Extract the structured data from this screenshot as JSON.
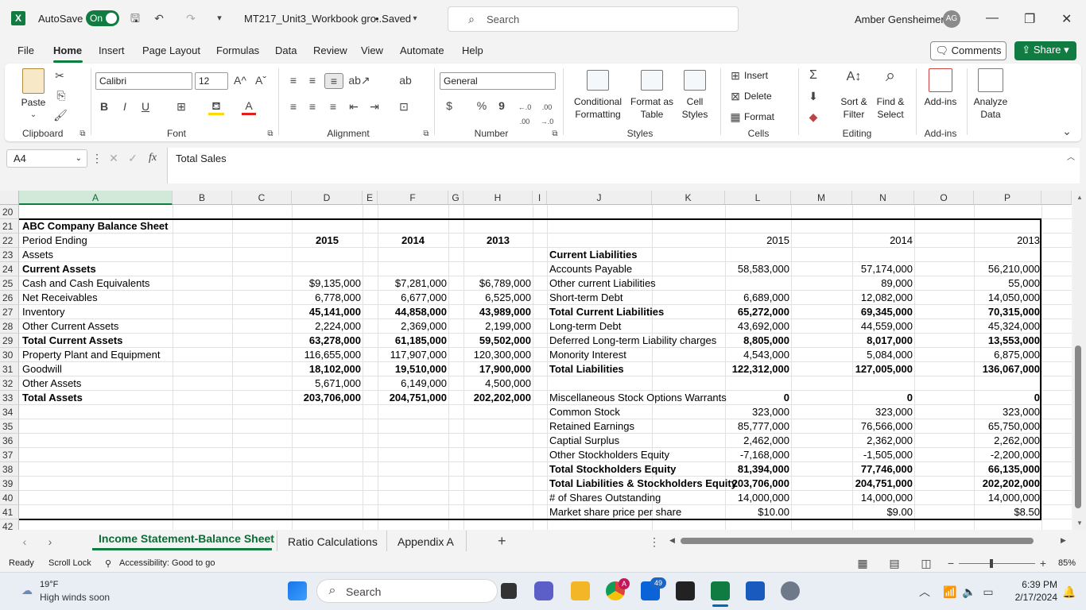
{
  "titlebar": {
    "autosave_label": "AutoSave",
    "autosave_state": "On",
    "filename": "MT217_Unit3_Workbook gro...",
    "saved_status": "• Saved",
    "search_placeholder": "Search",
    "user_name": "Amber Gensheimer",
    "user_initials": "AG"
  },
  "menu": {
    "items": [
      "File",
      "Home",
      "Insert",
      "Page Layout",
      "Formulas",
      "Data",
      "Review",
      "View",
      "Automate",
      "Help"
    ],
    "active": "Home",
    "comments_label": "Comments",
    "share_label": "Share"
  },
  "ribbon": {
    "clipboard": {
      "paste": "Paste",
      "label": "Clipboard"
    },
    "font": {
      "name": "Calibri",
      "size": "12",
      "bold": "B",
      "italic": "I",
      "underline": "U",
      "grow": "A^",
      "shrink": "Aˇ",
      "label": "Font"
    },
    "alignment": {
      "label": "Alignment"
    },
    "number": {
      "format": "General",
      "currency": "$",
      "percent": "%",
      "comma": "9",
      "inc_dec": "←.0 .00",
      "dec_dec": ".00 →.0",
      "label": "Number"
    },
    "styles": {
      "conditional_1": "Conditional",
      "conditional_2": "Formatting",
      "table_1": "Format as",
      "table_2": "Table",
      "cell_1": "Cell",
      "cell_2": "Styles",
      "label": "Styles"
    },
    "cells": {
      "insert": "Insert",
      "delete": "Delete",
      "format": "Format",
      "label": "Cells"
    },
    "editing": {
      "sort_1": "Sort &",
      "sort_2": "Filter",
      "find_1": "Find &",
      "find_2": "Select",
      "label": "Editing"
    },
    "addins": {
      "addins": "Add-ins",
      "label": "Add-ins"
    },
    "analyze": {
      "line1": "Analyze",
      "line2": "Data"
    }
  },
  "formula_bar": {
    "name_box": "A4",
    "fx": "fx",
    "content": "Total Sales"
  },
  "columns": [
    "A",
    "B",
    "C",
    "D",
    "E",
    "F",
    "G",
    "H",
    "I",
    "J",
    "K",
    "L",
    "M",
    "N",
    "O",
    "P"
  ],
  "rows": [
    "20",
    "21",
    "22",
    "23",
    "24",
    "25",
    "26",
    "27",
    "28",
    "29",
    "30",
    "31",
    "32",
    "33",
    "34",
    "35",
    "36",
    "37",
    "38",
    "39",
    "40",
    "41",
    "42"
  ],
  "sheet": {
    "rows": [
      {
        "A": "",
        "D": "",
        "F": "",
        "H": "",
        "J": "",
        "L": "",
        "N": "",
        "P": ""
      },
      {
        "A": "ABC Company Balance Sheet",
        "D": "",
        "F": "",
        "H": "",
        "J": "",
        "L": "",
        "N": "",
        "P": ""
      },
      {
        "A": "Period Ending",
        "D": "2015",
        "F": "2014",
        "H": "2013",
        "J": "",
        "L": "2015",
        "N": "2014",
        "P": "2013"
      },
      {
        "A": "Assets",
        "D": "",
        "F": "",
        "H": "",
        "J": "Current Liabilities",
        "L": "",
        "N": "",
        "P": ""
      },
      {
        "A": "Current Assets",
        "D": "",
        "F": "",
        "H": "",
        "J": "Accounts Payable",
        "L": "58,583,000",
        "N": "57,174,000",
        "P": "56,210,000"
      },
      {
        "A": "Cash and Cash Equivalents",
        "D": "$9,135,000",
        "F": "$7,281,000",
        "H": "$6,789,000",
        "J": "Other current Liabilities",
        "L": "",
        "N": "89,000",
        "P": "55,000"
      },
      {
        "A": "Net Receivables",
        "D": "6,778,000",
        "F": "6,677,000",
        "H": "6,525,000",
        "J": "Short-term Debt",
        "L": "6,689,000",
        "N": "12,082,000",
        "P": "14,050,000"
      },
      {
        "A": "Inventory",
        "D": "45,141,000",
        "F": "44,858,000",
        "H": "43,989,000",
        "J": "Total Current Liabilities",
        "L": "65,272,000",
        "N": "69,345,000",
        "P": "70,315,000"
      },
      {
        "A": "Other Current Assets",
        "D": "2,224,000",
        "F": "2,369,000",
        "H": "2,199,000",
        "J": "Long-term Debt",
        "L": "43,692,000",
        "N": "44,559,000",
        "P": "45,324,000"
      },
      {
        "A": "Total Current Assets",
        "D": "63,278,000",
        "F": "61,185,000",
        "H": "59,502,000",
        "J": "Deferred Long-term Liability charges",
        "L": "8,805,000",
        "N": "8,017,000",
        "P": "13,553,000"
      },
      {
        "A": "Property Plant and Equipment",
        "D": "116,655,000",
        "F": "117,907,000",
        "H": "120,300,000",
        "J": "Monority Interest",
        "L": "4,543,000",
        "N": "5,084,000",
        "P": "6,875,000"
      },
      {
        "A": "Goodwill",
        "D": "18,102,000",
        "F": "19,510,000",
        "H": "17,900,000",
        "J": "Total Liabilities",
        "L": "122,312,000",
        "N": "127,005,000",
        "P": "136,067,000"
      },
      {
        "A": "Other Assets",
        "D": "5,671,000",
        "F": "6,149,000",
        "H": "4,500,000",
        "J": "",
        "L": "",
        "N": "",
        "P": ""
      },
      {
        "A": "Total Assets",
        "D": "203,706,000",
        "F": "204,751,000",
        "H": "202,202,000",
        "J": "Miscellaneous Stock Options Warrants",
        "L": "0",
        "N": "0",
        "P": "0"
      },
      {
        "A": "",
        "D": "",
        "F": "",
        "H": "",
        "J": "Common Stock",
        "L": "323,000",
        "N": "323,000",
        "P": "323,000"
      },
      {
        "A": "",
        "D": "",
        "F": "",
        "H": "",
        "J": "Retained Earnings",
        "L": "85,777,000",
        "N": "76,566,000",
        "P": "65,750,000"
      },
      {
        "A": "",
        "D": "",
        "F": "",
        "H": "",
        "J": "Captial Surplus",
        "L": "2,462,000",
        "N": "2,362,000",
        "P": "2,262,000"
      },
      {
        "A": "",
        "D": "",
        "F": "",
        "H": "",
        "J": "Other Stockholders Equity",
        "L": "-7,168,000",
        "N": "-1,505,000",
        "P": "-2,200,000"
      },
      {
        "A": "",
        "D": "",
        "F": "",
        "H": "",
        "J": "Total Stockholders Equity",
        "L": "81,394,000",
        "N": "77,746,000",
        "P": "66,135,000"
      },
      {
        "A": "",
        "D": "",
        "F": "",
        "H": "",
        "J": "Total Liabilities & Stockholders Equity",
        "L": "203,706,000",
        "N": "204,751,000",
        "P": "202,202,000"
      },
      {
        "A": "",
        "D": "",
        "F": "",
        "H": "",
        "J": "# of Shares Outstanding",
        "L": "14,000,000",
        "N": "14,000,000",
        "P": "14,000,000"
      },
      {
        "A": "",
        "D": "",
        "F": "",
        "H": "",
        "J": "Market share price per share",
        "L": "$10.00",
        "N": "$9.00",
        "P": "$8.50"
      },
      {
        "A": "",
        "D": "",
        "F": "",
        "H": "",
        "J": "",
        "L": "",
        "N": "",
        "P": ""
      }
    ],
    "bold_rows": [
      1,
      2,
      4,
      7,
      9,
      11,
      13,
      18,
      19
    ],
    "bold_a_rows": [
      1,
      4,
      9,
      13
    ],
    "bold_j_rows": [
      3,
      7,
      11,
      18,
      19
    ]
  },
  "sheet_tabs": {
    "tabs": [
      "Income Statement-Balance Sheet",
      "Ratio Calculations",
      "Appendix A"
    ],
    "active": "Income Statement-Balance Sheet",
    "add": "+"
  },
  "status_bar": {
    "ready": "Ready",
    "scroll_lock": "Scroll Lock",
    "accessibility": "Accessibility: Good to go",
    "zoom": "85%"
  },
  "taskbar": {
    "temperature": "19°F",
    "weather": "High winds soon",
    "search": "Search",
    "mail_badge": "49",
    "chrome_badge": "A",
    "time": "6:39 PM",
    "date": "2/17/2024"
  },
  "colors": {
    "excel_green": "#107c41",
    "accent": "#0f6b36"
  }
}
